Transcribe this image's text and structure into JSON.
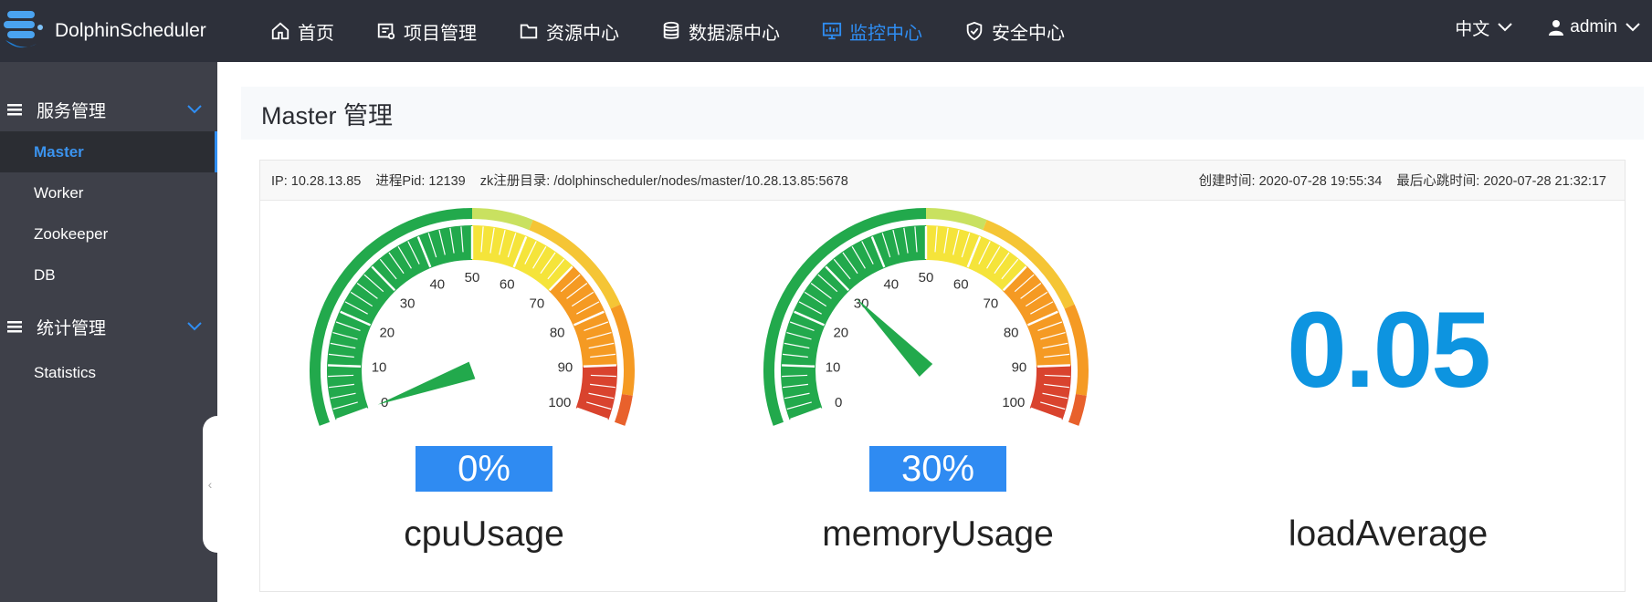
{
  "app": {
    "name": "DolphinScheduler"
  },
  "nav": [
    {
      "label": "首页",
      "icon": "home-icon"
    },
    {
      "label": "项目管理",
      "icon": "project-icon"
    },
    {
      "label": "资源中心",
      "icon": "folder-icon"
    },
    {
      "label": "数据源中心",
      "icon": "database-icon"
    },
    {
      "label": "监控中心",
      "icon": "monitor-icon",
      "active": true
    },
    {
      "label": "安全中心",
      "icon": "shield-icon"
    }
  ],
  "topright": {
    "lang": "中文",
    "user": "admin"
  },
  "sidebar": {
    "groups": [
      {
        "label": "服务管理",
        "items": [
          "Master",
          "Worker",
          "Zookeeper",
          "DB"
        ]
      },
      {
        "label": "统计管理",
        "items": [
          "Statistics"
        ]
      }
    ],
    "active_item": "Master",
    "collapse_glyph": "‹"
  },
  "main": {
    "title": "Master 管理",
    "info": {
      "ip": "IP: 10.28.13.85",
      "pid": "进程Pid: 12139",
      "zk": "zk注册目录: /dolphinscheduler/nodes/master/10.28.13.85:5678",
      "created": "创建时间: 2020-07-28 19:55:34",
      "heartbeat": "最后心跳时间: 2020-07-28 21:32:17"
    },
    "gauges": [
      {
        "name": "cpuUsage",
        "value": 0,
        "display": "0%"
      },
      {
        "name": "memoryUsage",
        "value": 30,
        "display": "30%"
      }
    ],
    "gauge_ticks": [
      "0",
      "10",
      "20",
      "30",
      "40",
      "50",
      "60",
      "70",
      "80",
      "90",
      "100"
    ],
    "load": {
      "name": "loadAverage",
      "value": "0.05"
    }
  },
  "colors": {
    "topbar": "#2d303a",
    "sidebar": "#3e4049",
    "accent": "#2f8ef4",
    "green": "#22a94c",
    "yellow": "#f5e43a",
    "orange": "#f59a23",
    "red": "#d9432e",
    "load": "#0d94e0"
  }
}
